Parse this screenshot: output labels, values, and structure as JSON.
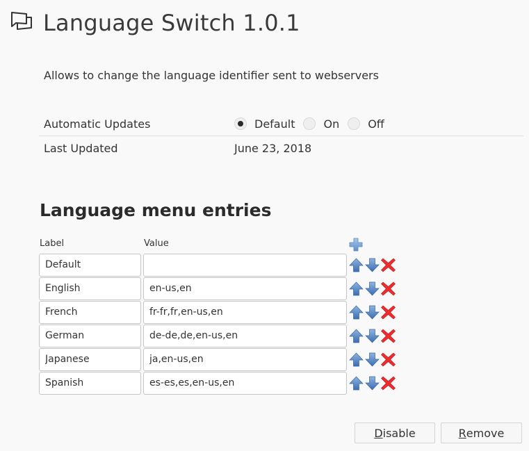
{
  "header": {
    "icon": "addon-speech-bubbles-icon",
    "title": "Language Switch 1.0.1"
  },
  "description": "Allows to change the language identifier sent to webservers",
  "details": {
    "automatic_updates": {
      "label": "Automatic Updates",
      "options": [
        {
          "label": "Default",
          "checked": true
        },
        {
          "label": "On",
          "checked": false
        },
        {
          "label": "Off",
          "checked": false
        }
      ]
    },
    "last_updated": {
      "label": "Last Updated",
      "value": "June 23, 2018"
    }
  },
  "entries_section": {
    "title": "Language menu entries",
    "column_label": "Label",
    "column_value": "Value",
    "add_icon": "plus-icon",
    "rows": [
      {
        "label": "Default",
        "value": ""
      },
      {
        "label": "English",
        "value": "en-us,en"
      },
      {
        "label": "French",
        "value": "fr-fr,fr,en-us,en"
      },
      {
        "label": "German",
        "value": "de-de,de,en-us,en"
      },
      {
        "label": "Japanese",
        "value": "ja,en-us,en"
      },
      {
        "label": "Spanish",
        "value": "es-es,es,en-us,en"
      }
    ]
  },
  "buttons": {
    "disable": {
      "accesskey": "D",
      "rest": "isable"
    },
    "remove": {
      "accesskey": "R",
      "rest": "emove"
    }
  },
  "colors": {
    "arrow_blue": "#4a7fc0",
    "delete_red": "#e8242a",
    "plus_blue": "#7aa9dc"
  }
}
